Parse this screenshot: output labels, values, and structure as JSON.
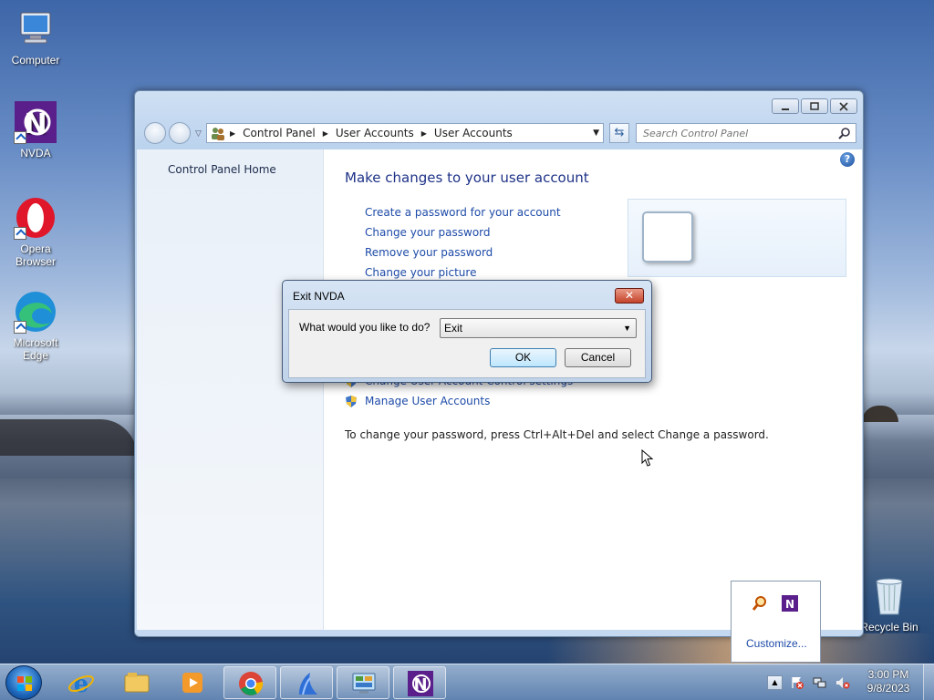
{
  "desktop": {
    "icons": [
      {
        "label": "Computer"
      },
      {
        "label": "NVDA"
      },
      {
        "label": "Opera Browser"
      },
      {
        "label": "Microsoft Edge"
      },
      {
        "label": "Recycle Bin"
      }
    ]
  },
  "explorer": {
    "address": {
      "crumbs": [
        "Control Panel",
        "User Accounts",
        "User Accounts"
      ]
    },
    "search_placeholder": "Search Control Panel",
    "help": "?",
    "sidebar": {
      "home": "Control Panel Home"
    },
    "heading": "Make changes to your user account",
    "tasks": [
      "Create a password for your account",
      "Change your password",
      "Remove your password",
      "Change your picture"
    ],
    "partial_task": "Change User Account Control settings",
    "manage": "Manage User Accounts",
    "note": "To change your password, press Ctrl+Alt+Del and select Change a password."
  },
  "dialog": {
    "title": "Exit NVDA",
    "close": "✕",
    "question": "What would you like to do?",
    "selected": "Exit",
    "ok": "OK",
    "cancel": "Cancel"
  },
  "tray_flyout": {
    "customize": "Customize..."
  },
  "taskbar": {
    "clock_time": "3:00 PM",
    "clock_date": "9/8/2023"
  },
  "colors": {
    "link": "#1e4ba8",
    "heading": "#1e3287"
  }
}
